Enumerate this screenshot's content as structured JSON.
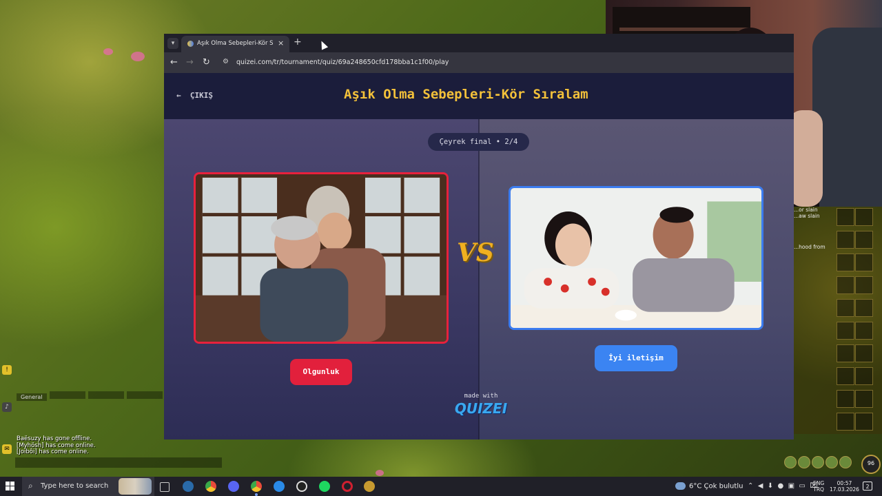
{
  "game": {
    "chat_tabs": [
      "General",
      "",
      "",
      ""
    ],
    "chat_lines": [
      "Baësuzy has gone offline.",
      "[Myhösh] has come online.",
      "[Joibôi] has come online."
    ],
    "combat_log": [
      "...or slain",
      "...aw slain",
      "...hood from"
    ],
    "level": "96"
  },
  "browser": {
    "tab_title": "Aşık Olma Sebepleri-Kör Sıralam",
    "new_tab_label": "+",
    "close_label": "×",
    "url": "quizei.com/tr/tournament/quiz/69a248650cfd178bba1c1f00/play"
  },
  "page": {
    "exit_label": "ÇIKIŞ",
    "title": "Aşık Olma Sebepleri-Kör Sıralam",
    "round_label": "Çeyrek final • 2/4",
    "vs_label": "VS",
    "left_choice": "Olgunluk",
    "right_choice": "İyi iletişim",
    "made_with": "made with",
    "logo": "QUIZEI",
    "colors": {
      "left_accent": "#e8213c",
      "right_accent": "#3b7cf0",
      "title_color": "#f3c13a"
    }
  },
  "taskbar": {
    "search_placeholder": "Type here to search",
    "weather": "6°C  Çok bulutlu",
    "lang_line1": "ENG",
    "lang_line2": "TRQ",
    "time": "00:57",
    "date": "17.03.2026",
    "notifications": "2",
    "icons": [
      "task-view-icon",
      "steam-icon",
      "chrome-icon",
      "discord-icon",
      "chrome-icon",
      "app-icon",
      "obs-icon",
      "spotify-icon",
      "opera-icon",
      "wow-icon"
    ]
  }
}
